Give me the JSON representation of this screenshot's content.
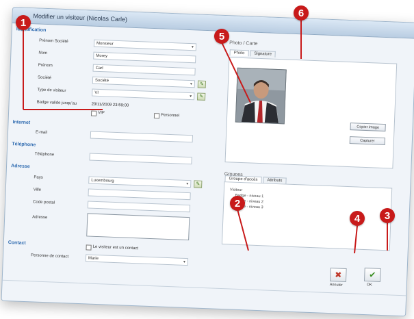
{
  "window": {
    "title": "Modifier un visiteur (Nicolas Carle)"
  },
  "sections": {
    "identification": "Identification",
    "internet": "Internet",
    "telephone": "Téléphone",
    "address": "Adresse",
    "contact": "Contact"
  },
  "identification": {
    "civility_label": "Prénom Société",
    "civility_value": "Monsieur",
    "nom_label": "Nom",
    "nom_value": "Morey",
    "prenom_label": "Prénom",
    "prenom_value": "Carl",
    "societe_label": "Société",
    "societe_value": "Société",
    "type_label": "Type de visiteur",
    "type_value": "VI",
    "date_label": "Badge valide jusqu'au",
    "date_value": "20/11/2009 23:59:00",
    "check1_label": "VIP",
    "check2_label": "Personnel"
  },
  "internet": {
    "email_label": "E-mail"
  },
  "telephone": {
    "phone_label": "Téléphone"
  },
  "address": {
    "pays_label": "Pays",
    "pays_value": "Luxembourg",
    "ville_label": "Ville",
    "cp_label": "Code postal",
    "adresse_label": "Adresse"
  },
  "contact": {
    "check_label": "Le visiteur est un contact",
    "person_label": "Personne de contact",
    "person_value": "Marie"
  },
  "photo": {
    "panel_title": "Photo / Carte",
    "tab1": "Photo",
    "tab2": "Signature",
    "btn1": "Copier image",
    "btn2": "Capturer"
  },
  "groups": {
    "panel_title": "Groupes",
    "tab1": "Groupe d'accès",
    "tab2": "Attributs",
    "items": [
      "Visiteur",
      "Badge - niveau 1",
      "Badge - niveau 2",
      "Badge - niveau 3"
    ]
  },
  "footer": {
    "cancel_label": "Annuler",
    "ok_label": "OK"
  },
  "callouts": [
    "1",
    "2",
    "3",
    "4",
    "5",
    "6"
  ],
  "colors": {
    "callout": "#c81a1a",
    "accent": "#2f6bb0"
  }
}
